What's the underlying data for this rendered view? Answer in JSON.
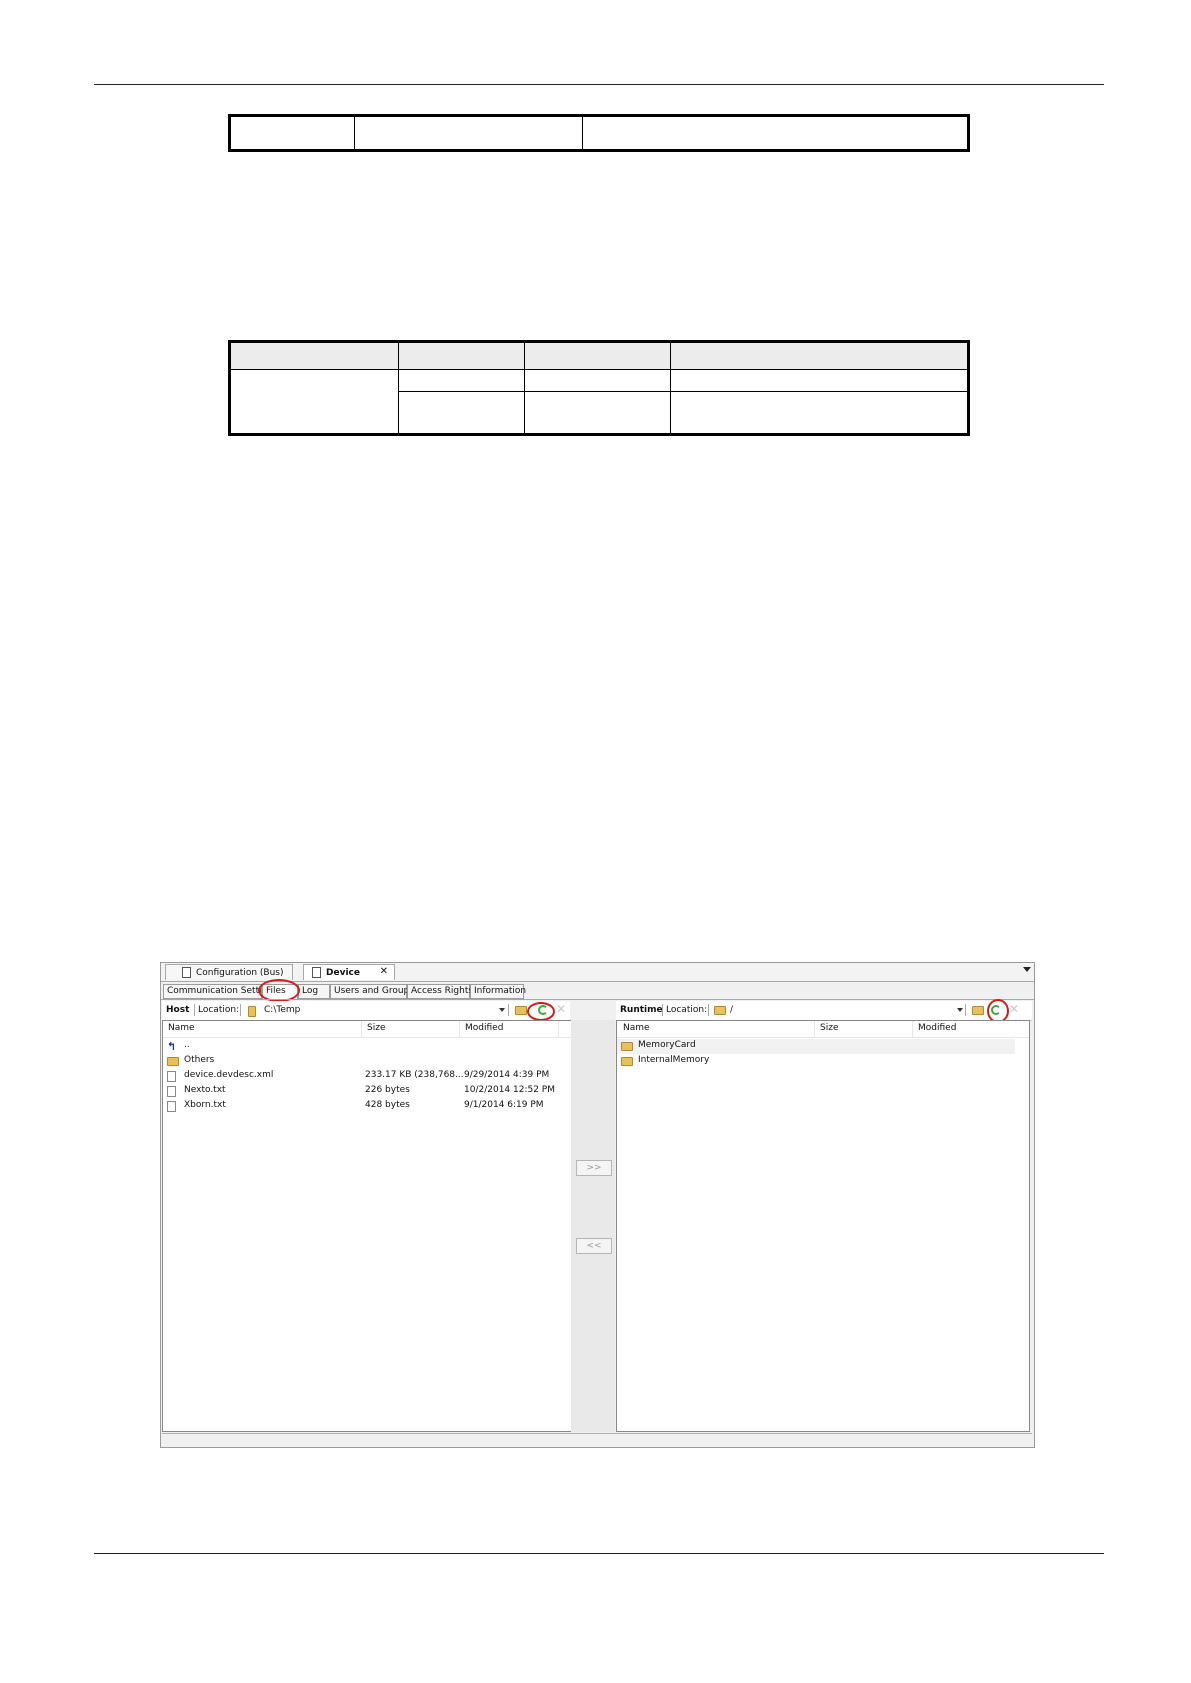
{
  "device_window": {
    "doc_tabs": [
      {
        "label": "Configuration (Bus)"
      },
      {
        "label": "Device"
      }
    ],
    "sub_tabs": [
      {
        "label": "Communication Settings"
      },
      {
        "label": "Files"
      },
      {
        "label": "Log"
      },
      {
        "label": "Users and Groups"
      },
      {
        "label": "Access Rights"
      },
      {
        "label": "Information"
      }
    ],
    "host": {
      "title": "Host",
      "location_label": "Location:",
      "location_value": "C:\\Temp",
      "columns": {
        "name": "Name",
        "size": "Size",
        "modified": "Modified"
      },
      "rows": [
        {
          "name": "..",
          "size": "",
          "modified": "",
          "icon": "up-folder-icon"
        },
        {
          "name": "Others",
          "size": "",
          "modified": "",
          "icon": "folder-icon"
        },
        {
          "name": "device.devdesc.xml",
          "size": "233.17 KB (238,768...",
          "modified": "9/29/2014 4:39 PM",
          "icon": "file-icon"
        },
        {
          "name": "Nexto.txt",
          "size": "226 bytes",
          "modified": "10/2/2014 12:52 PM",
          "icon": "file-icon"
        },
        {
          "name": "Xborn.txt",
          "size": "428 bytes",
          "modified": "9/1/2014 6:19 PM",
          "icon": "file-icon"
        }
      ]
    },
    "runtime": {
      "title": "Runtime",
      "location_label": "Location:",
      "location_value": "/",
      "columns": {
        "name": "Name",
        "size": "Size",
        "modified": "Modified"
      },
      "rows": [
        {
          "name": "MemoryCard",
          "size": "",
          "modified": "",
          "icon": "folder-icon"
        },
        {
          "name": "InternalMemory",
          "size": "",
          "modified": "",
          "icon": "folder-icon"
        }
      ]
    },
    "transfer": {
      "to_runtime": ">>",
      "to_host": "<<"
    }
  }
}
